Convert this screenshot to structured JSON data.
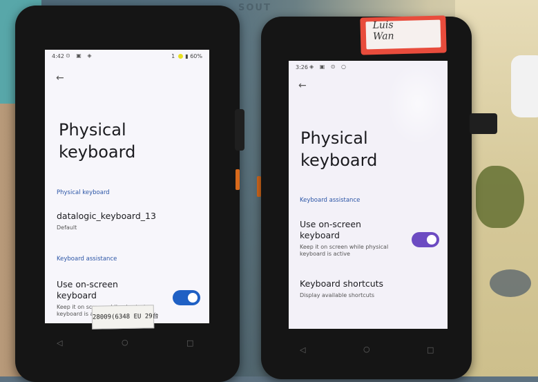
{
  "background": {
    "mat_text": "SOUT"
  },
  "left_phone": {
    "status": {
      "time": "4:42",
      "indicator": "1",
      "battery": "60%"
    },
    "title": "Physical keyboard",
    "section_physical": "Physical keyboard",
    "keyboard_name": "datalogic_keyboard_13",
    "keyboard_layout": "Default",
    "section_assistance": "Keyboard assistance",
    "osk_title": "Use on-screen keyboard",
    "osk_subtitle": "Keep it on screen while physical keyboard is active",
    "osk_enabled": true,
    "sticker_text": "28009(6348 EU 29台",
    "accent_color": "#1f60c4"
  },
  "right_phone": {
    "status": {
      "time": "3:26"
    },
    "name_tag": {
      "line1": "Luis",
      "line2": "Wan"
    },
    "title": "Physical keyboard",
    "section_assistance": "Keyboard assistance",
    "osk_title": "Use on-screen keyboard",
    "osk_subtitle": "Keep it on screen while physical keyboard is active",
    "osk_enabled": true,
    "shortcuts_title": "Keyboard shortcuts",
    "shortcuts_subtitle": "Display available shortcuts",
    "accent_color": "#6c4bc2"
  }
}
